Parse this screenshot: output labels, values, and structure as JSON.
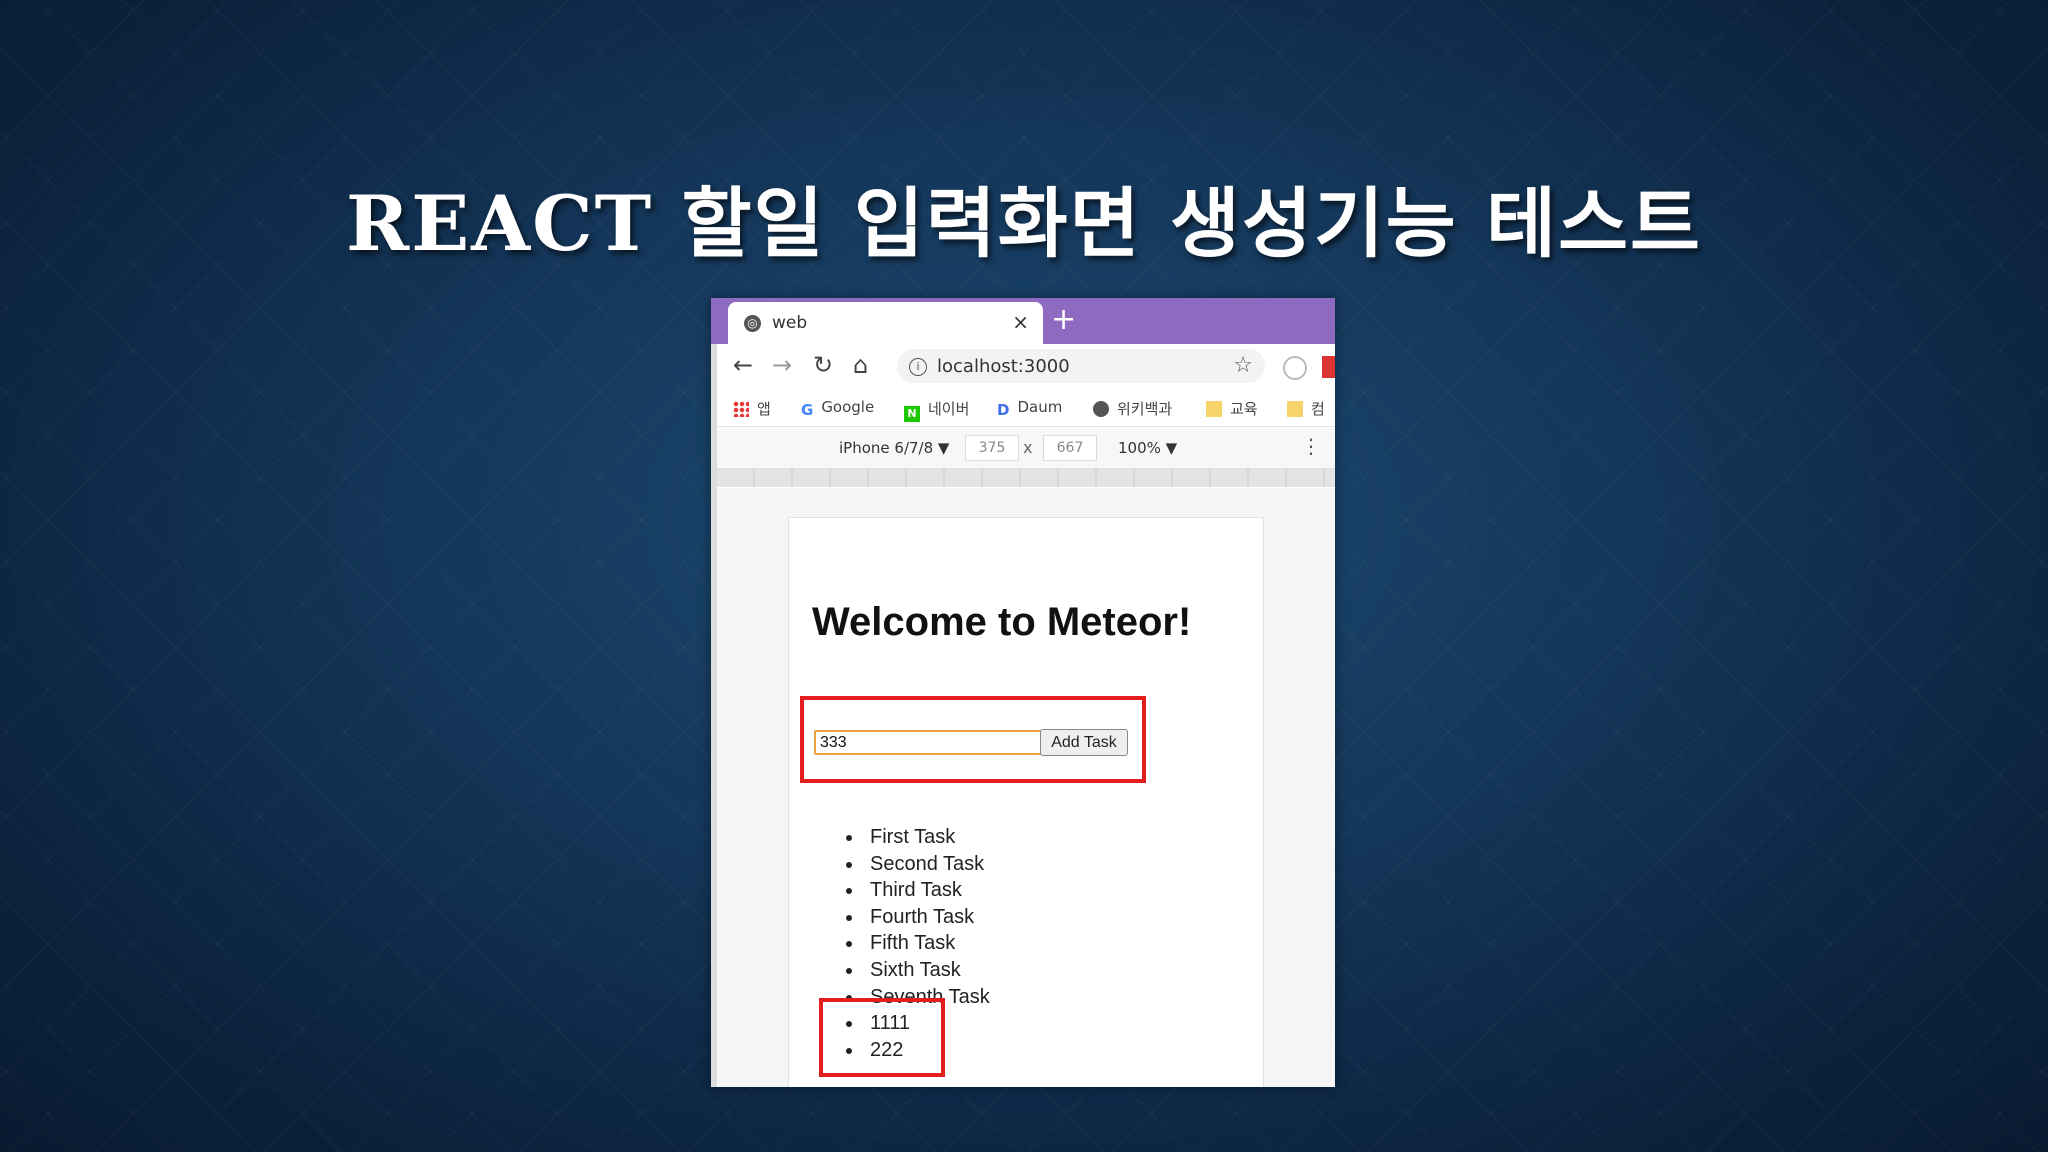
{
  "slide": {
    "title": "REACT 할일 입력화면 생성기능 테스트"
  },
  "browser": {
    "tab_title": "web",
    "tab_close": "×",
    "new_tab": "+",
    "url": "localhost:3000",
    "bookmarks": [
      {
        "label": "앱",
        "icon": "apps-grid-icon"
      },
      {
        "label": "Google",
        "icon": "google-icon"
      },
      {
        "label": "네이버",
        "icon": "naver-icon"
      },
      {
        "label": "Daum",
        "icon": "daum-icon"
      },
      {
        "label": "위키백과",
        "icon": "globe-icon"
      },
      {
        "label": "교육",
        "icon": "folder-icon"
      },
      {
        "label": "컴",
        "icon": "folder-icon"
      }
    ],
    "devtools": {
      "device": "iPhone 6/7/8 ▼",
      "width": "375",
      "x": "x",
      "height": "667",
      "zoom": "100% ▼"
    }
  },
  "app": {
    "heading": "Welcome to Meteor!",
    "input_value": "333",
    "add_button": "Add Task",
    "tasks": [
      "First Task",
      "Second Task",
      "Third Task",
      "Fourth Task",
      "Fifth Task",
      "Sixth Task",
      "Seventh Task",
      "1111",
      "222"
    ]
  },
  "colors": {
    "tab_bar": "#8e6bc0",
    "highlight": "#e41e1e",
    "input_focus": "#e8a33d"
  }
}
